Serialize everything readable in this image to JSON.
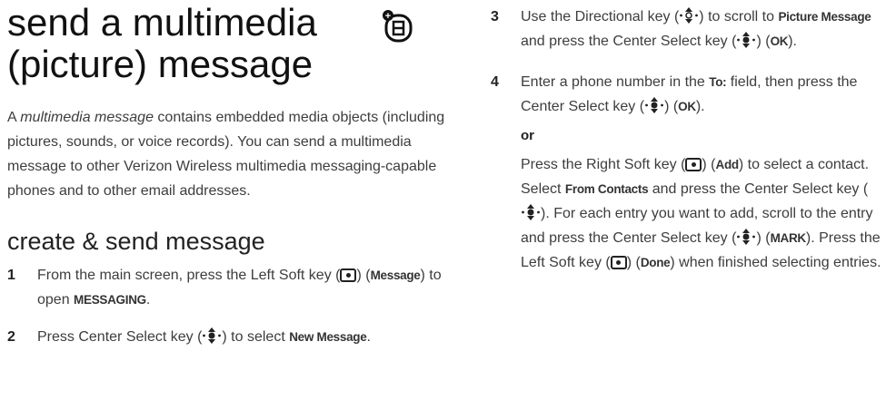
{
  "title": "send a multimedia (picture) message",
  "title_icon": "message-icon",
  "intro": {
    "before": "A ",
    "term": "multimedia message",
    "after": " contains embedded media objects (including pictures, sounds, or voice records). You can send a multimedia message to other Verizon Wireless multimedia messaging-capable phones and to other email addresses."
  },
  "subhead": "create & send message",
  "steps": {
    "s1": {
      "num": "1",
      "a": "From the main screen, press the Left Soft key (",
      "b": ") (",
      "soft": "Message",
      "c": ") to open ",
      "menu": "MESSAGING",
      "d": "."
    },
    "s2": {
      "num": "2",
      "a": "Press Center Select key (",
      "b": ") to select ",
      "item": "New Message",
      "c": "."
    },
    "s3": {
      "num": "3",
      "a": "Use the Directional key (",
      "b": ") to scroll to ",
      "item": "Picture Message",
      "c": " and press the Center Select key (",
      "d": ") (",
      "ok": "OK",
      "e": ")."
    },
    "s4": {
      "num": "4",
      "a": "Enter a phone number in the ",
      "field": "To:",
      "b": " field, then press the Center Select key (",
      "c": ") (",
      "ok": "OK",
      "d": ")."
    },
    "or": "or",
    "s4b": {
      "a": "Press the Right Soft key (",
      "b": ") (",
      "add": "Add",
      "c": ") to select a contact. Select ",
      "from": "From Contacts",
      "d": " and press the Center Select key (",
      "e": "). For each entry you want to add, scroll to the entry and press the Center Select key (",
      "f": ") (",
      "mark": "MARK",
      "g": "). Press the Left Soft key (",
      "h": ") (",
      "done": "Done",
      "i": ") when finished selecting entries."
    }
  }
}
